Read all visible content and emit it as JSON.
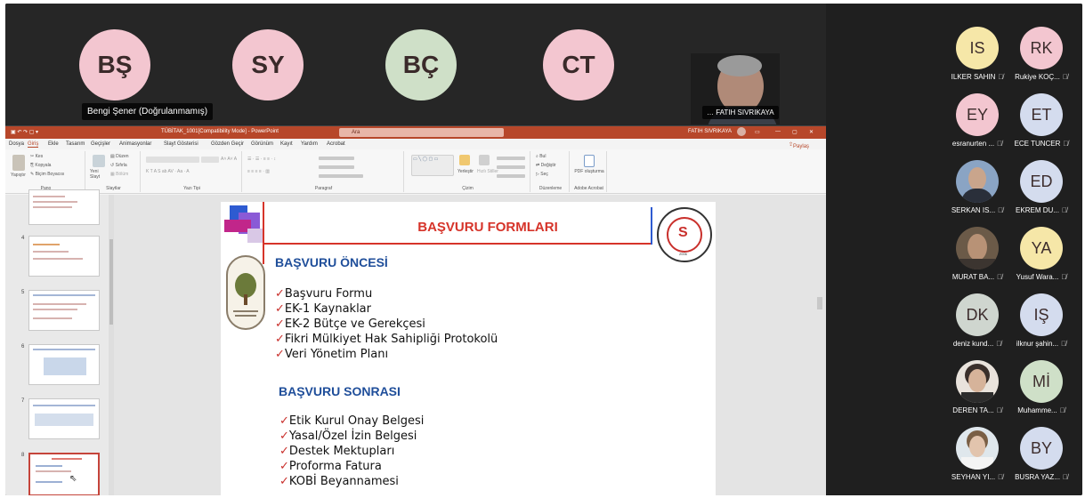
{
  "meeting": {
    "top_participants": [
      {
        "initials": "BŞ",
        "color": "#f3c6d0"
      },
      {
        "initials": "SY",
        "color": "#f3c6d0"
      },
      {
        "initials": "BÇ",
        "color": "#cfe0c8"
      },
      {
        "initials": "CT",
        "color": "#f3c6d0"
      }
    ],
    "hover_name": "Bengi Şener (Doğrulanmamış)",
    "video_name": "FATIH SIVRIKAYA"
  },
  "ppt": {
    "window_title": "TÜBİTAK_1001[Compatibility Mode] - PowerPoint",
    "search_placeholder": "Ara",
    "user": "FATIH SIVRIKAYA",
    "share": "Paylaş",
    "tabs": [
      "Dosya",
      "Giriş",
      "Ekle",
      "Tasarım",
      "Geçişler",
      "Animasyonlar",
      "Slayt Gösterisi",
      "Gözden Geçir",
      "Görünüm",
      "Kayıt",
      "Yardım",
      "Acrobat"
    ],
    "ribbon_groups": [
      "Pano",
      "Slaytlar",
      "Yazı Tipi",
      "Paragraf",
      "Çizim",
      "Düzenleme",
      "Adobe Acrobat"
    ],
    "ribbon_labels": {
      "kes": "Kes",
      "kopyala": "Kopyala",
      "bicim": "Biçim Boyacısı",
      "yapistir": "Yapıştır",
      "yeni": "Yeni Slayt",
      "duzen": "Düzen",
      "sifirla": "Sıfırla",
      "bolum": "Bölüm",
      "bul": "Bul",
      "degistir": "Değiştir",
      "sec": "Seç",
      "pdf": "PDF oluşturma",
      "yerlestir": "Yerleştir",
      "hizli": "Hızlı Stiller"
    },
    "thumbnails": [
      {
        "num": "4"
      },
      {
        "num": "5"
      },
      {
        "num": "6"
      },
      {
        "num": "7"
      },
      {
        "num": "8"
      }
    ],
    "slide": {
      "title": "BAŞVURU FORMLARI",
      "section1": "BAŞVURU ÖNCESİ",
      "items1": [
        "Başvuru Formu",
        "EK-1 Kaynaklar",
        "EK-2 Bütçe ve Gerekçesi",
        "Fikri Mülkiyet Hak Sahipliği Protokolü",
        "Veri Yönetim Planı"
      ],
      "section2": "BAŞVURU SONRASI",
      "items2": [
        "Etik Kurul Onay Belgesi",
        "Yasal/Özel İzin Belgesi",
        "Destek Mektupları",
        "Proforma Fatura",
        "KOBİ Beyannamesi"
      ],
      "check": "✓",
      "logo_right_text": "KASTAMONU UNIVERSITY",
      "logo_right_year": "2006"
    }
  },
  "participants": [
    {
      "initials": "IS",
      "name": "ILKER SAHIN",
      "color": "#f6e7a8"
    },
    {
      "initials": "RK",
      "name": "Rukiye KOÇ...",
      "color": "#f3c6d0"
    },
    {
      "initials": "EY",
      "name": "esranurten ...",
      "color": "#f3c6d0"
    },
    {
      "initials": "ET",
      "name": "ECE TUNCER",
      "color": "#d4dcee"
    },
    {
      "initials": "",
      "name": "SERKAN IS...",
      "color": "#8aa4c4",
      "photo": true
    },
    {
      "initials": "ED",
      "name": "EKREM DU...",
      "color": "#d4dcee"
    },
    {
      "initials": "",
      "name": "MURAT BA...",
      "color": "#6b5a48",
      "photo": true
    },
    {
      "initials": "YA",
      "name": "Yusuf Wara...",
      "color": "#f6e7a8"
    },
    {
      "initials": "DK",
      "name": "deniz kund...",
      "color": "#cfd6cf"
    },
    {
      "initials": "IŞ",
      "name": "ilknur şahin...",
      "color": "#d4dcee"
    },
    {
      "initials": "",
      "name": "DEREN TA...",
      "color": "#e9e3dc",
      "photo": true
    },
    {
      "initials": "Mİ",
      "name": "Muhamme...",
      "color": "#cfe0c8"
    },
    {
      "initials": "",
      "name": "SEYHAN YI...",
      "color": "#dfe7ec",
      "photo": true
    },
    {
      "initials": "BY",
      "name": "BUSRA YAZ...",
      "color": "#d4dcee"
    }
  ],
  "mic_icon": "mic-off-icon"
}
